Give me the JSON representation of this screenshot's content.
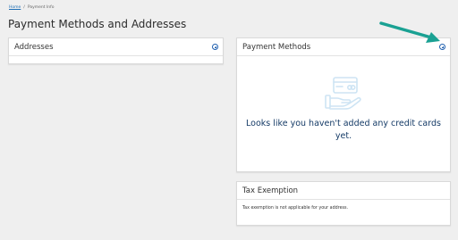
{
  "breadcrumb": {
    "home": "Home",
    "separator": "/",
    "current": "Payment Info"
  },
  "page": {
    "title": "Payment Methods and Addresses"
  },
  "addresses": {
    "title": "Addresses"
  },
  "payment_methods": {
    "title": "Payment Methods",
    "empty_message": "Looks like you haven't added any credit cards yet."
  },
  "tax_exemption": {
    "title": "Tax Exemption",
    "message": "Tax exemption is not applicable for your address."
  },
  "colors": {
    "accent": "#1f5fae",
    "arrow": "#1aa193",
    "empty_icon": "#cde4f4",
    "message": "#143a66"
  }
}
